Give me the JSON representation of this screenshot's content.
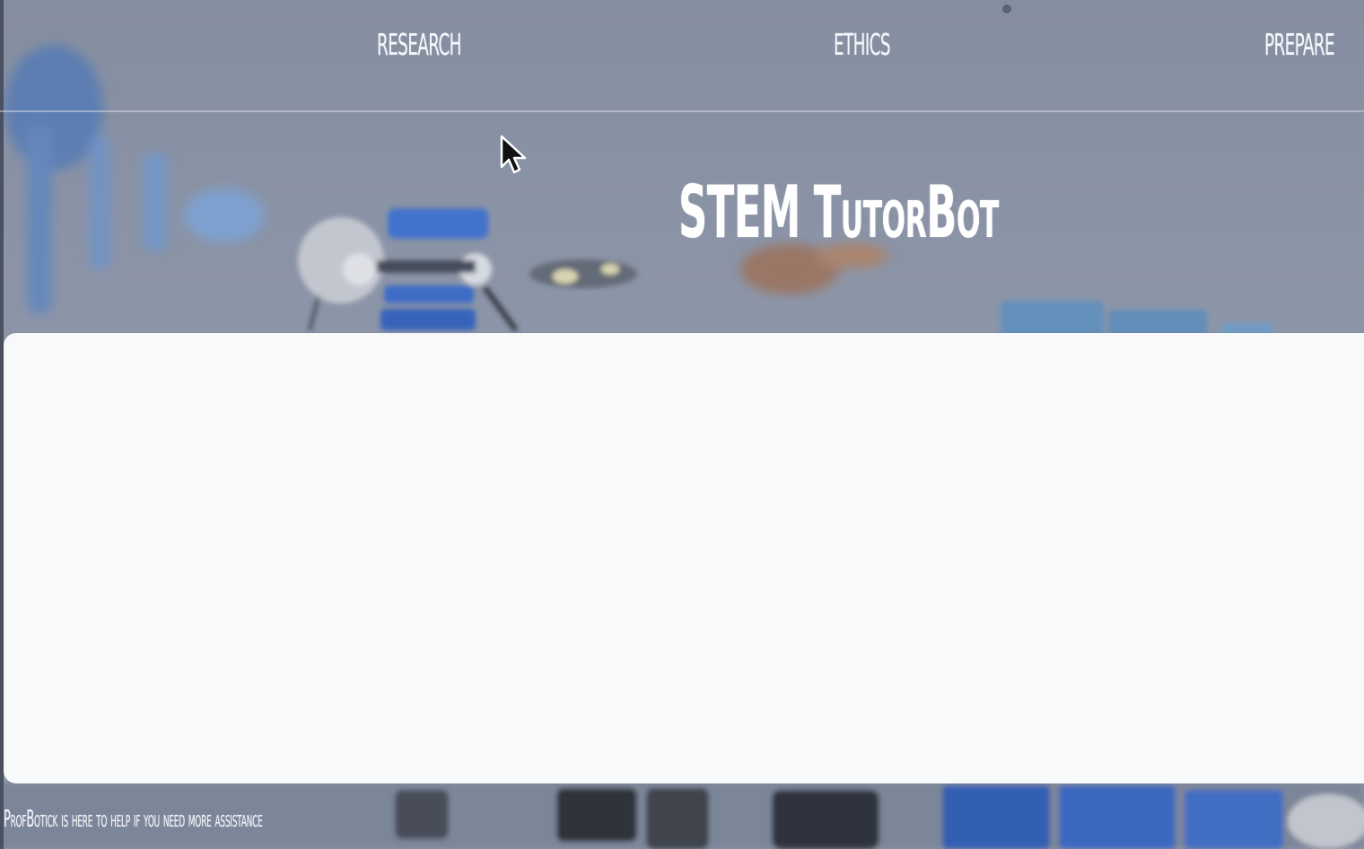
{
  "nav": {
    "items": [
      {
        "label": "RESEARCH"
      },
      {
        "label": "ETHICS"
      },
      {
        "label": "PREPARE"
      }
    ]
  },
  "hero": {
    "title": "STEM TutorBot"
  },
  "footer": {
    "assistance_text": "ProfBotick is here to help if you need more assistance"
  },
  "colors": {
    "overlay": "#8a93a5",
    "panel": "#f8f9fb",
    "text": "#ffffff"
  },
  "icons": {
    "cursor": "mouse-pointer-icon"
  }
}
